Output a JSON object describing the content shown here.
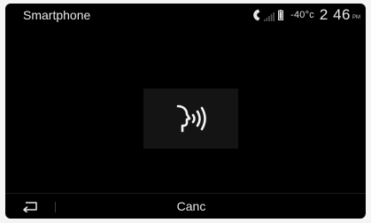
{
  "header": {
    "title": "Smartphone",
    "temperature": "-40°c",
    "time": "2 46",
    "ampm": "PM"
  },
  "icons": {
    "phone": "phone-icon",
    "signal": "signal-strength-icon",
    "battery": "battery-icon",
    "voice": "voice-recognition-icon",
    "back": "back-arrow-icon"
  },
  "footer": {
    "cancel_label": "Canc"
  },
  "colors": {
    "background": "#000000",
    "text": "#e8e8e8",
    "voice_panel": "#141414"
  }
}
